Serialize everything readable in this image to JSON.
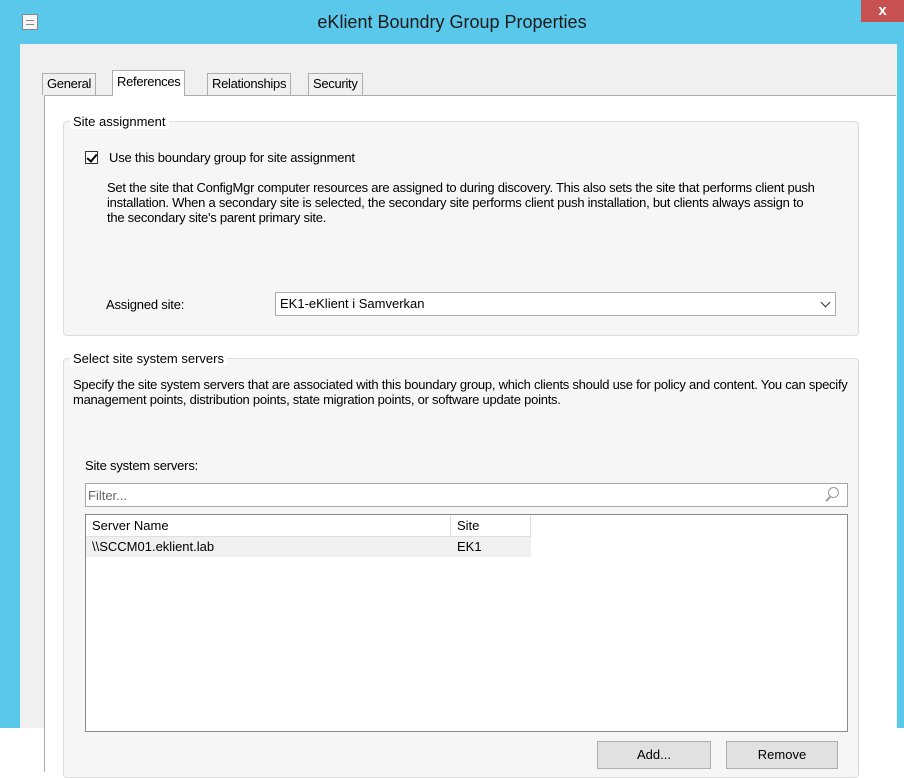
{
  "window": {
    "title": "eKlient Boundry Group Properties",
    "close_label": "x"
  },
  "tabs": [
    {
      "label": "General",
      "active": false
    },
    {
      "label": "References",
      "active": true
    },
    {
      "label": "Relationships",
      "active": false
    },
    {
      "label": "Security",
      "active": false
    }
  ],
  "site_assignment": {
    "legend": "Site assignment",
    "checkbox_label": "Use this boundary group for site assignment",
    "checked": true,
    "description": "Set the site that ConfigMgr computer resources are assigned to during discovery. This also sets the site that performs client push installation. When a secondary site is selected, the secondary site performs client push installation, but clients always assign to the secondary site's parent primary site.",
    "assigned_site_label": "Assigned site:",
    "assigned_site_value": "EK1-eKlient i Samverkan"
  },
  "site_servers": {
    "legend": "Select site system servers",
    "description": "Specify the site system servers that are associated with this boundary group, which clients should use for policy and content. You can specify management points, distribution points, state migration points, or software update points.",
    "list_label": "Site system servers:",
    "filter_placeholder": "Filter...",
    "columns": [
      "Server Name",
      "Site"
    ],
    "rows": [
      {
        "server": "\\\\SCCM01.eklient.lab",
        "site": "EK1"
      }
    ],
    "add_label": "Add...",
    "remove_label": "Remove"
  },
  "colors": {
    "title_bar": "#5ac8ea",
    "close_button": "#c75050",
    "dialog_background": "#f0f0f0"
  }
}
